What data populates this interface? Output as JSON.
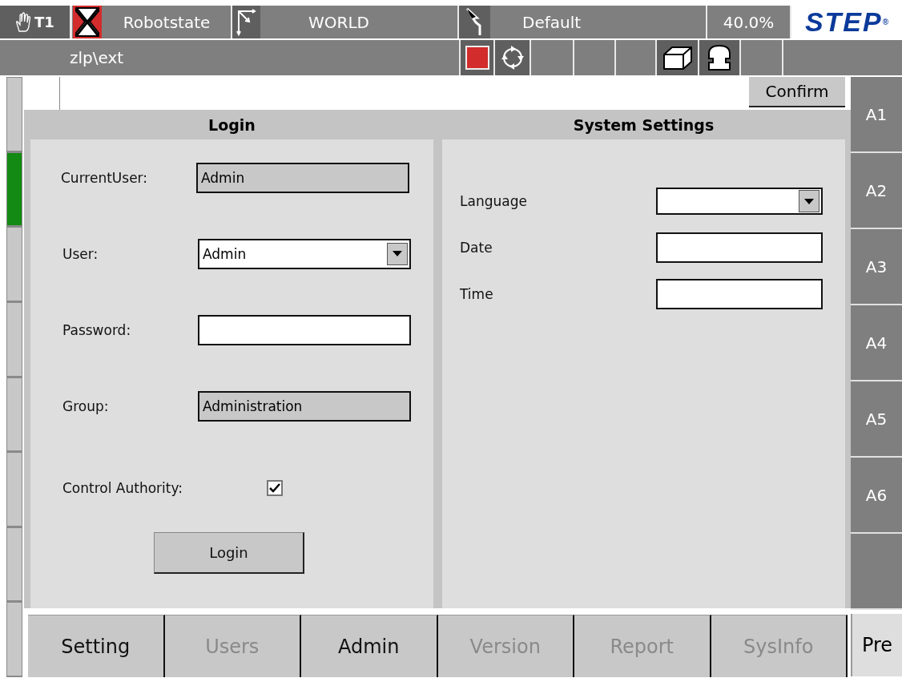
{
  "status_bar": {
    "mode": "T1",
    "robot_state": "Robotstate",
    "coordinate_system": "WORLD",
    "tool": "Default",
    "override": "40.0%",
    "logo": "STEP",
    "logo_mark": "®",
    "program_path": "zlp\\ext"
  },
  "command_bar": {
    "confirm_button": "Confirm"
  },
  "side_keys": [
    {
      "active": false
    },
    {
      "active": true
    },
    {
      "active": false
    },
    {
      "active": false
    },
    {
      "active": false
    },
    {
      "active": false
    },
    {
      "active": false
    },
    {
      "active": false
    }
  ],
  "login": {
    "title": "Login",
    "fields": [
      {
        "kind": "readonly",
        "label": "CurrentUser:",
        "value": "Admin"
      },
      {
        "kind": "dropdown",
        "label": "User:",
        "value": "Admin"
      },
      {
        "kind": "password",
        "label": "Password:"
      },
      {
        "kind": "readonly",
        "label": "Group:",
        "value": "Administration"
      },
      {
        "kind": "checkbox",
        "label": "Control Authority:",
        "checked": true
      }
    ],
    "button": "Login"
  },
  "system_settings": {
    "title": "System Settings",
    "fields": [
      {
        "kind": "dropdown",
        "label": "Language"
      },
      {
        "kind": "text",
        "label": "Date"
      },
      {
        "kind": "text",
        "label": "Time"
      }
    ]
  },
  "axis_keys": [
    {
      "label": "A1"
    },
    {
      "label": "A2"
    },
    {
      "label": "A3"
    },
    {
      "label": "A4"
    },
    {
      "label": "A5"
    },
    {
      "label": "A6"
    }
  ],
  "tabs": [
    {
      "label": "Setting",
      "disabled": false
    },
    {
      "label": "Users",
      "disabled": true
    },
    {
      "label": "Admin",
      "disabled": false
    },
    {
      "label": "Version",
      "disabled": true
    },
    {
      "label": "Report",
      "disabled": true
    },
    {
      "label": "SysInfo",
      "disabled": true
    }
  ],
  "pre_button": "Pre"
}
